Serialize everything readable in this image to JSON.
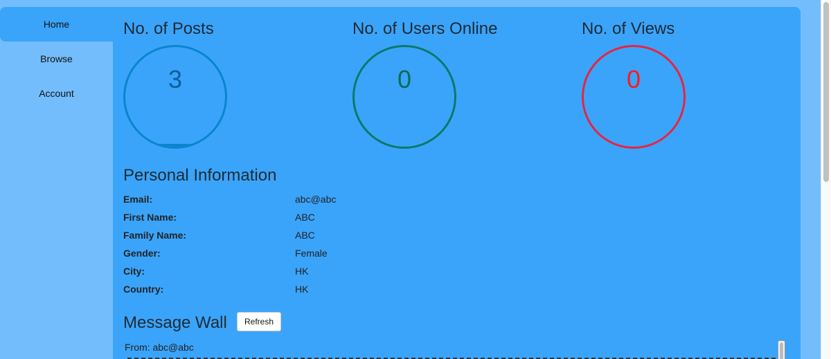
{
  "sidebar": {
    "items": [
      {
        "label": "Home",
        "active": true
      },
      {
        "label": "Browse",
        "active": false
      },
      {
        "label": "Account",
        "active": false
      }
    ]
  },
  "stats": [
    {
      "title": "No. of Posts",
      "value": "3",
      "color": "#0a85cc",
      "text_color": "#0b5f9a",
      "fill_fraction": 0.03
    },
    {
      "title": "No. of Users Online",
      "value": "0",
      "color": "#0a7a66",
      "text_color": "#0a6b58",
      "fill_fraction": 0
    },
    {
      "title": "No. of Views",
      "value": "0",
      "color": "#e8243f",
      "text_color": "#ff1a1a",
      "fill_fraction": 0
    }
  ],
  "personal": {
    "title": "Personal Information",
    "rows": [
      {
        "label": "Email:",
        "value": "abc@abc"
      },
      {
        "label": "First Name:",
        "value": "ABC"
      },
      {
        "label": "Family Name:",
        "value": "ABC"
      },
      {
        "label": "Gender:",
        "value": "Female"
      },
      {
        "label": "City:",
        "value": "HK"
      },
      {
        "label": "Country:",
        "value": "HK"
      }
    ]
  },
  "wall": {
    "title": "Message Wall",
    "refresh_label": "Refresh",
    "messages": [
      {
        "from": "From: abc@abc"
      }
    ]
  },
  "colors": {
    "page_bg": "#74bdfd",
    "panel_bg": "#3aa4fb"
  }
}
